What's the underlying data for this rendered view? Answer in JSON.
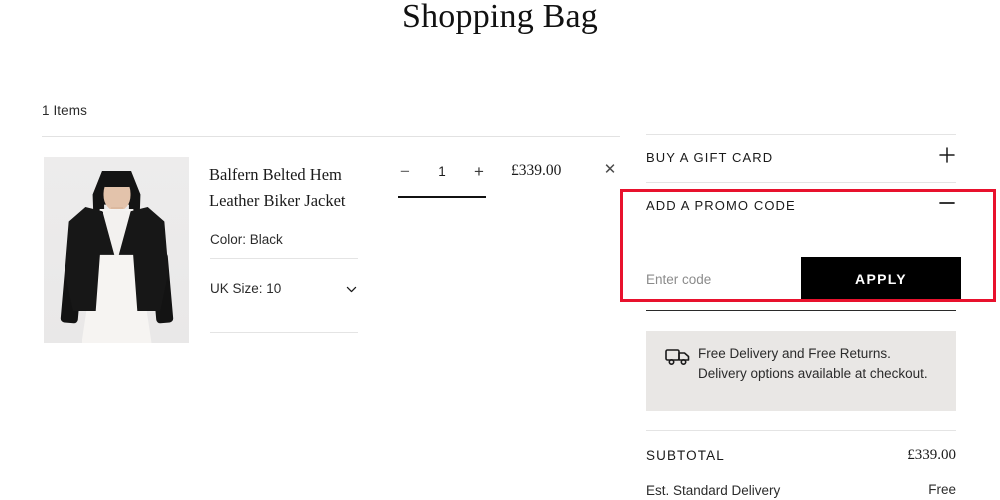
{
  "header": {
    "title": "Shopping Bag"
  },
  "bag": {
    "items_count_label": "1 Items",
    "item": {
      "name": "Balfern Belted Hem Leather Biker Jacket",
      "color_label": "Color: Black",
      "size_label": "UK Size: 10",
      "size_chevron_icon": "chevron-down-icon",
      "quantity": "1",
      "decrease_icon": "minus-icon",
      "increase_icon": "plus-icon",
      "price": "£339.00",
      "remove_icon": "close-icon",
      "image_alt": "model-wearing-black-leather-biker-jacket"
    }
  },
  "summary": {
    "gift_card": {
      "label": "BUY A GIFT CARD",
      "toggle_icon": "plus-icon",
      "expanded": false
    },
    "promo": {
      "label": "ADD A PROMO CODE",
      "toggle_icon": "minus-icon",
      "expanded": true,
      "input_value": "",
      "input_placeholder": "Enter code",
      "apply_label": "APPLY"
    },
    "delivery_banner": {
      "icon": "delivery-truck-icon",
      "text": "Free Delivery and Free Returns. Delivery options available at checkout."
    },
    "subtotal": {
      "label": "SUBTOTAL",
      "value": "£339.00"
    },
    "est_delivery": {
      "label": "Est. Standard Delivery",
      "value": "Free"
    }
  },
  "annotation": {
    "highlight_color": "#e8112d",
    "target": "add-a-promo-code-section"
  }
}
